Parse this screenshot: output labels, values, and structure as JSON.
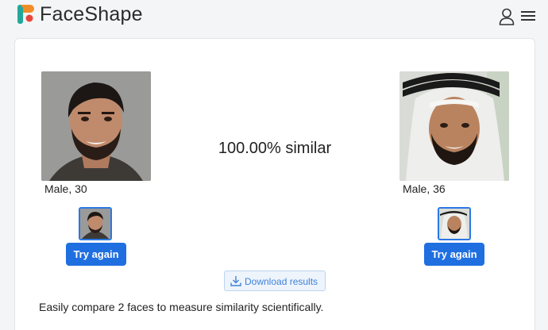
{
  "header": {
    "brand": "FaceShape",
    "logo_colors": {
      "orange": "#f28c28",
      "teal": "#22a89a",
      "red": "#e8453c"
    }
  },
  "comparison": {
    "left": {
      "caption": "Male, 30"
    },
    "right": {
      "caption": "Male, 36"
    },
    "similarity_text": "100.00% similar"
  },
  "buttons": {
    "try_again_left": "Try again",
    "try_again_right": "Try again",
    "download": "Download results"
  },
  "tagline": "Easily compare 2 faces to measure similarity scientifically.",
  "colors": {
    "accent": "#1f6fe0",
    "download_text": "#3f82d9",
    "download_bg": "#eef4fc"
  }
}
